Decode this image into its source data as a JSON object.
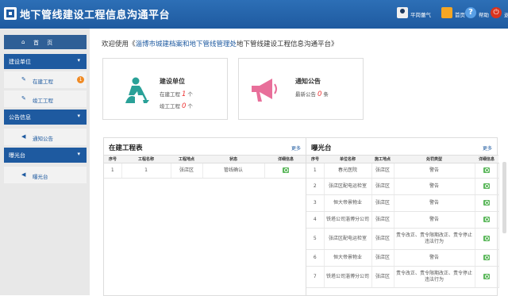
{
  "header": {
    "title": "地下管线建设工程信息沟通平台",
    "user_label": "平岗蕾气",
    "home_label": "首页",
    "help_label": "帮助",
    "logout_label": "退出"
  },
  "sidebar": {
    "home_label": "首 页",
    "sections": [
      {
        "label": "建设单位",
        "items": [
          {
            "label": "在建工程",
            "badge": "1"
          },
          {
            "label": "竣工工程"
          }
        ]
      },
      {
        "label": "公告信息",
        "items": [
          {
            "label": "通知公告"
          }
        ]
      },
      {
        "label": "曝光台",
        "items": [
          {
            "label": "曝光台"
          }
        ]
      }
    ]
  },
  "welcome": {
    "prefix": "欢迎使用《",
    "highlight": "淄博市城建档案和地下管线管理处",
    "suffix": "地下管线建设工程信息沟通平台》"
  },
  "cards": {
    "construction": {
      "title": "建设单位",
      "line1_label": "在建工程",
      "line1_value": "1",
      "line1_unit": "个",
      "line2_label": "竣工工程",
      "line2_value": "0",
      "line2_unit": "个"
    },
    "notice": {
      "title": "通知公告",
      "line1_label": "最新公告",
      "line1_value": "0",
      "line1_unit": "条"
    }
  },
  "in_progress": {
    "title": "在建工程表",
    "more": "更多",
    "headers": [
      "序号",
      "工程名称",
      "工程地点",
      "状态",
      "详细信息"
    ],
    "rows": [
      {
        "no": "1",
        "name": "1",
        "place": "张店区",
        "status": "管线确认"
      }
    ]
  },
  "exposure": {
    "title": "曝光台",
    "more": "更多",
    "headers": [
      "序号",
      "单位名称",
      "施工地点",
      "处罚类型",
      "详细信息"
    ],
    "rows": [
      {
        "no": "1",
        "name": "春光医院",
        "place": "张店区",
        "type": "警告"
      },
      {
        "no": "2",
        "name": "张店区配电运检室",
        "place": "张店区",
        "type": "警告"
      },
      {
        "no": "3",
        "name": "恒大帝景物业",
        "place": "张店区",
        "type": "警告"
      },
      {
        "no": "4",
        "name": "铁塔公司淄博分公司",
        "place": "张店区",
        "type": "警告"
      },
      {
        "no": "5",
        "name": "张店区配电运检室",
        "place": "张店区",
        "type": "责令改正、责令限期改正、责令停止违法行为"
      },
      {
        "no": "6",
        "name": "恒大帝景物业",
        "place": "张店区",
        "type": "警告"
      },
      {
        "no": "7",
        "name": "铁塔公司淄博分公司",
        "place": "张店区",
        "type": "责令改正、责令限期改正、责令停止违法行为"
      }
    ]
  }
}
